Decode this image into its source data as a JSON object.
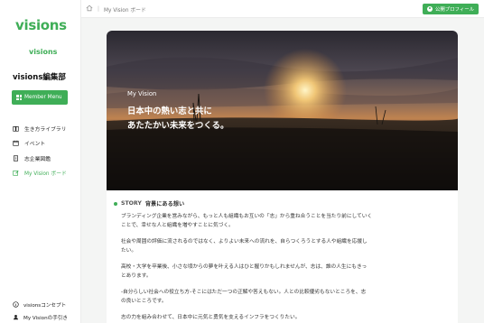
{
  "sidebar": {
    "logo": "visions",
    "logo_sub": "visions",
    "org_name": "visions編集部",
    "member_menu": "Member Menu",
    "nav": [
      {
        "label": "生き方ライブラリ",
        "icon": "book-icon"
      },
      {
        "label": "イベント",
        "icon": "calendar-icon"
      },
      {
        "label": "志企業図鑑",
        "icon": "building-icon"
      },
      {
        "label": "My Vision ボード",
        "icon": "edit-icon"
      }
    ],
    "bottom": [
      {
        "label": "visionsコンセプト",
        "icon": "info-icon"
      },
      {
        "label": "My Visionの手引き",
        "icon": "user-icon"
      }
    ]
  },
  "topbar": {
    "breadcrumb_current": "My Vision ボード",
    "profile_button": "公開プロフィール"
  },
  "hero": {
    "label": "My Vision",
    "line1": "日本中の熱い志と共に",
    "line2": "あたたかい未来をつくる。"
  },
  "story": {
    "en": "STORY",
    "ja": "背景にある想い",
    "paragraphs": [
      [
        "ブランディング企業を営みながら、もっと人も組織もお互いの「志」から重ね合うことを当たり前にしていく",
        "ことで、幸せな人と組織を増やすことに気づく。"
      ],
      [
        "社会や周囲の評価に流されるのではなく、よりよい未来への流れを、自らつくろうとする人や組織を応援し",
        "たい。"
      ],
      [
        "高校・大学を卒業後、小さな頃からの夢を叶える人はひと握りかもしれませんが、志は、誰の人生にもきっ",
        "とあります。"
      ],
      [
        "-自分らしい社会への役立ち方-そこにはただ一つの正解や答えもない。人との比較優劣もないところを、志",
        "の良いところです。"
      ],
      [
        "志の力を組み合わせて、日本中に元気と勇気を支えるインフラをつくりたい。"
      ]
    ]
  },
  "colors": {
    "accent": "#3fae57"
  }
}
